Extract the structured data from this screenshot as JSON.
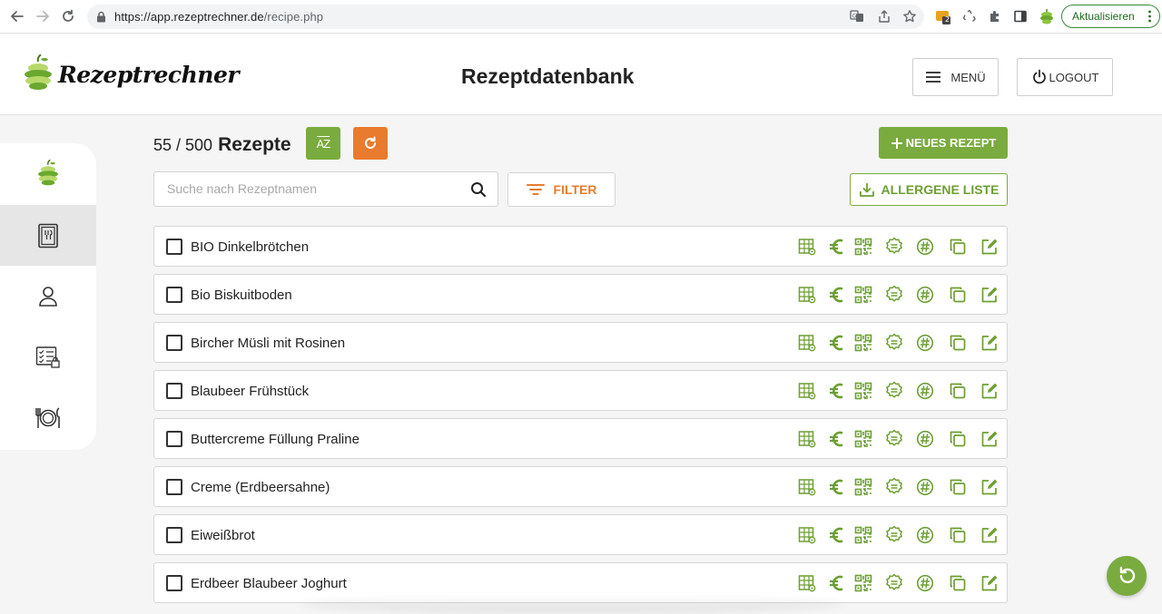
{
  "browser": {
    "url_host": "https://app.rezeptrechner.de",
    "url_path": "/recipe.php",
    "ext_badge": "2",
    "update_label": "Aktualisieren"
  },
  "header": {
    "logo_text": "Rezeptrechner",
    "title": "Rezeptdatenbank",
    "menu_label": "MENÜ",
    "logout_label": "LOGOUT"
  },
  "sidenav": {
    "items": [
      {
        "icon": "apple-logo-icon",
        "active": false
      },
      {
        "icon": "recipe-book-icon",
        "active": true
      },
      {
        "icon": "user-icon",
        "active": false
      },
      {
        "icon": "checklist-lock-icon",
        "active": false
      },
      {
        "icon": "cutlery-plate-icon",
        "active": false
      }
    ]
  },
  "toolbar": {
    "count": "55 / 500",
    "count_label": "Rezepte",
    "az_label": "AZ",
    "new_recipe_label": "NEUES REZEPT",
    "search_placeholder": "Suche nach Rezeptnamen",
    "filter_label": "FILTER",
    "allergen_label": "ALLERGENE LISTE"
  },
  "recipes": [
    "BIO Dinkelbrötchen",
    "Bio Biskuitboden",
    "Bircher Müsli mit Rosinen",
    "Blaubeer Frühstück",
    "Buttercreme Füllung Praline",
    "Creme (Erdbeersahne)",
    "Eiweißbrot",
    "Erdbeer Blaubeer Joghurt"
  ],
  "row_actions": [
    "nutrition-table-icon",
    "euro-icon",
    "qr-code-icon",
    "badge-icon",
    "nutri-score-icon",
    "copy-icon",
    "edit-icon"
  ],
  "colors": {
    "accent_green": "#7aab3e",
    "accent_orange": "#e87b2e"
  }
}
